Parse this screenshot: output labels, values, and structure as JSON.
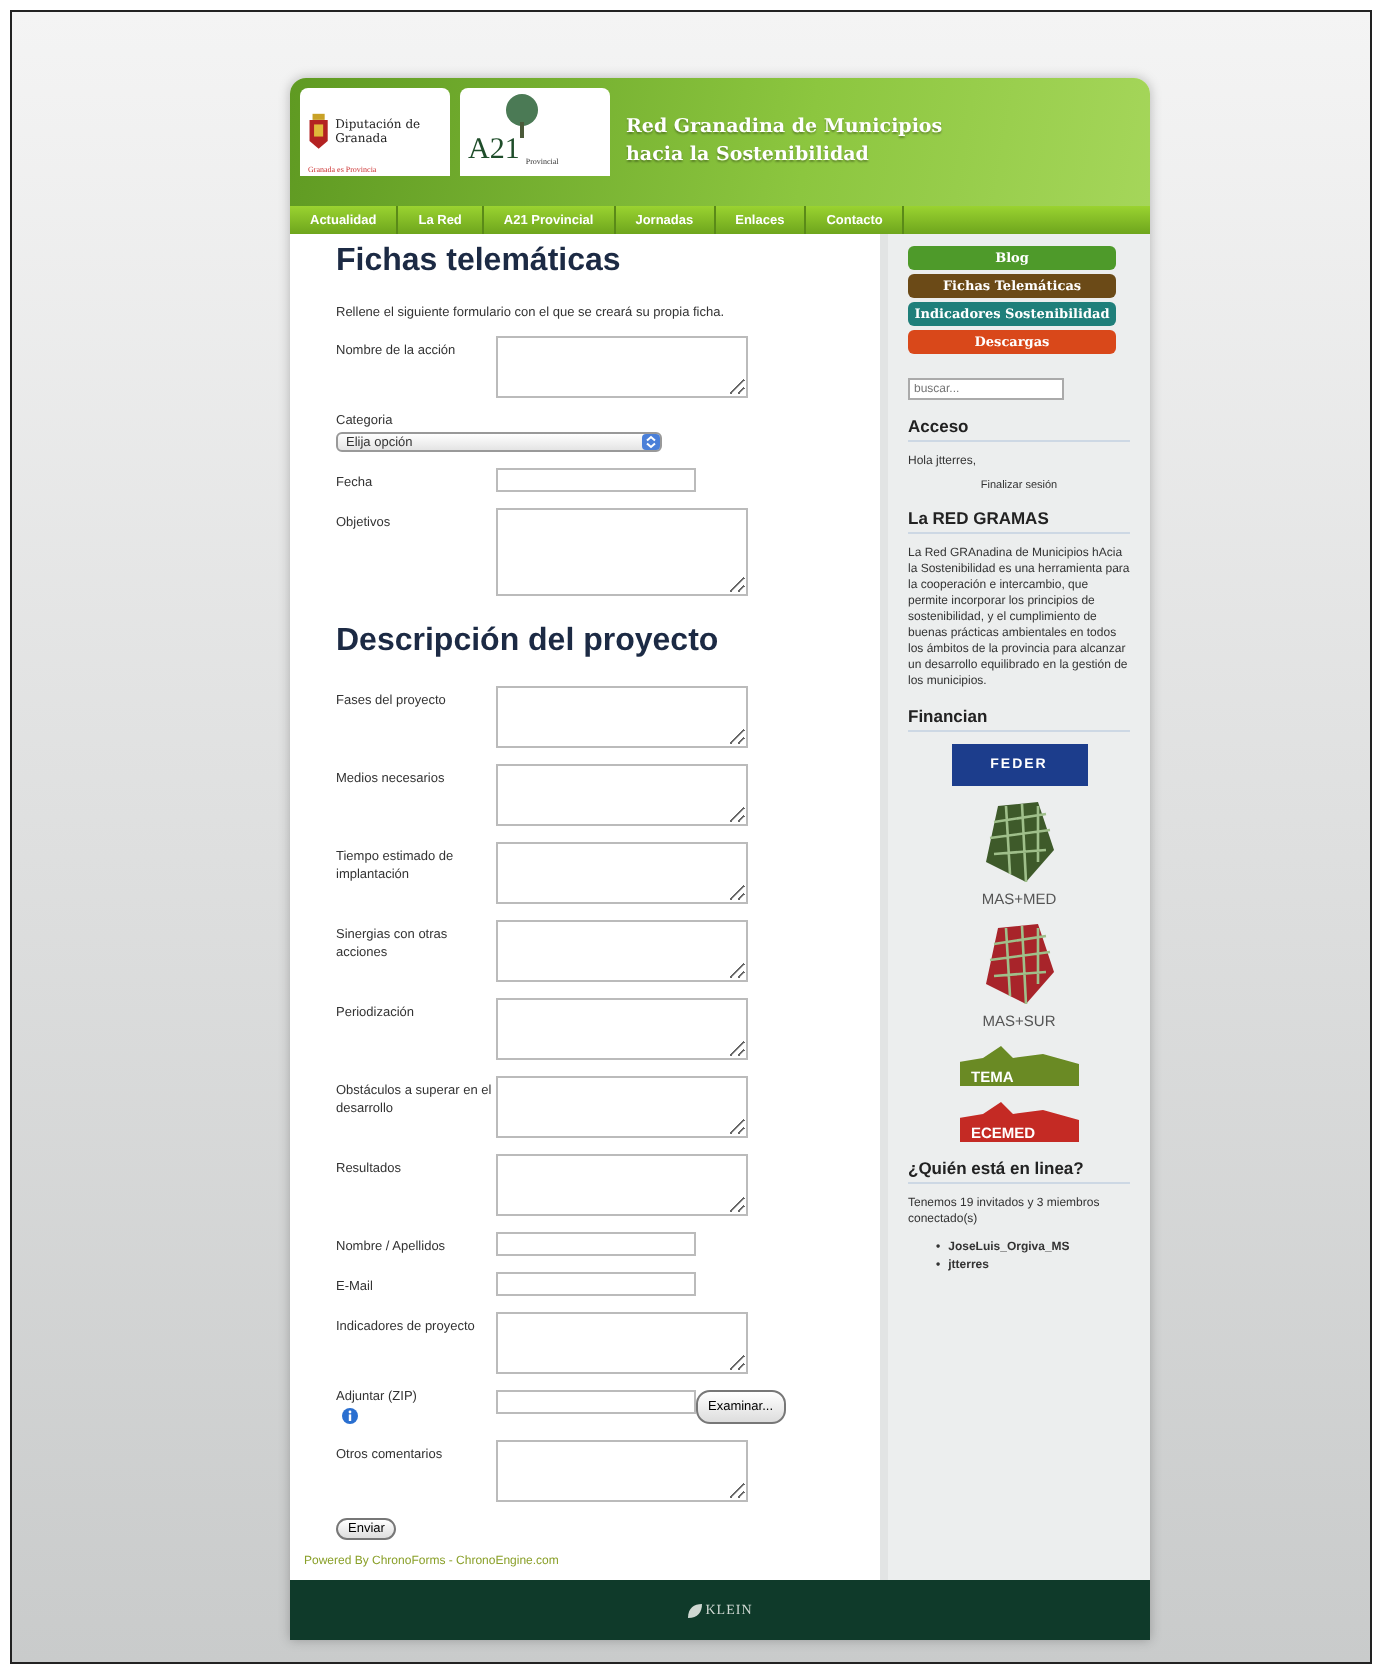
{
  "header": {
    "logo_text": "Diputación de Granada",
    "logo_subtext": "Granada es Provincia",
    "a21_text": "A21",
    "a21_subtext": "Provincial",
    "title_lines": [
      "Red Granadina de Municipios",
      "hacia la Sostenibilidad"
    ]
  },
  "nav": [
    {
      "label": "Actualidad"
    },
    {
      "label": "La Red"
    },
    {
      "label": "A21 Provincial"
    },
    {
      "label": "Jornadas"
    },
    {
      "label": "Enlaces"
    },
    {
      "label": "Contacto"
    }
  ],
  "form": {
    "title": "Fichas telemáticas",
    "intro": "Rellene el siguiente formulario con el que se creará su propia ficha.",
    "fields": [
      {
        "kind": "textarea",
        "label": "Nombre de la acción"
      },
      {
        "kind": "select",
        "label": "Categoria",
        "value": "Elija opción"
      },
      {
        "kind": "text",
        "label": "Fecha"
      },
      {
        "kind": "bigtextarea",
        "label": "Objetivos"
      },
      {
        "kind": "heading",
        "label": "Descripción del proyecto"
      },
      {
        "kind": "textarea",
        "label": "Fases del proyecto"
      },
      {
        "kind": "textarea",
        "label": "Medios necesarios"
      },
      {
        "kind": "textarea",
        "label": "Tiempo estimado de implantación"
      },
      {
        "kind": "textarea",
        "label": "Sinergias con otras acciones"
      },
      {
        "kind": "textarea",
        "label": "Periodización"
      },
      {
        "kind": "textarea",
        "label": "Obstáculos a superar en el desarrollo"
      },
      {
        "kind": "textarea",
        "label": "Resultados"
      },
      {
        "kind": "text",
        "label": "Nombre / Apellidos"
      },
      {
        "kind": "text",
        "label": "E-Mail"
      },
      {
        "kind": "textarea",
        "label": "Indicadores de proyecto"
      },
      {
        "kind": "file",
        "label": "Adjuntar (ZIP)",
        "button": "Examinar...",
        "info_icon": true
      },
      {
        "kind": "textarea",
        "label": "Otros comentarios"
      }
    ],
    "submit": "Enviar",
    "powered": "Powered By ChronoForms - ChronoEngine.com"
  },
  "sidebar": {
    "menu": [
      {
        "label": "Blog",
        "color": "#4e9a2a"
      },
      {
        "label": "Fichas Telemáticas",
        "color": "#6b4a17"
      },
      {
        "label": "Indicadores Sostenibilidad",
        "color": "#1f7f7a"
      },
      {
        "label": "Descargas",
        "color": "#d9481a"
      }
    ],
    "search": {
      "placeholder": "buscar..."
    },
    "access": {
      "title": "Acceso",
      "greeting": "Hola jtterres,",
      "logout": "Finalizar sesión"
    },
    "about": {
      "title": "La RED GRAMAS",
      "text": "La Red GRAnadina de Municipios hAcia la Sostenibilidad es una herramienta para la cooperación e intercambio, que permite incorporar los principios de sostenibilidad, y el cumplimiento de buenas prácticas ambientales en todos los ámbitos de la provincia para alcanzar un desarrollo equilibrado en la gestión de los municipios."
    },
    "funders": {
      "title": "Financian",
      "logos": [
        {
          "kind": "feder",
          "text": "FEDER"
        },
        {
          "kind": "mas",
          "text": "MAS+MED",
          "color": "#3e5a2a"
        },
        {
          "kind": "mas",
          "text": "MAS+SUR",
          "color": "#a8242a"
        },
        {
          "kind": "town",
          "text": "TEMA",
          "color": "#6a8a24"
        },
        {
          "kind": "town",
          "text": "ECEMED",
          "color": "#c42a24"
        }
      ]
    },
    "online": {
      "title": "¿Quién está en linea?",
      "text": "Tenemos 19 invitados y 3 miembros conectado(s)",
      "users": [
        {
          "bullet": "•",
          "name": "JoseLuis_Orgiva_MS"
        },
        {
          "bullet": "•",
          "name": "jtterres"
        }
      ]
    }
  },
  "footer": {
    "brand": "KLEIN"
  }
}
